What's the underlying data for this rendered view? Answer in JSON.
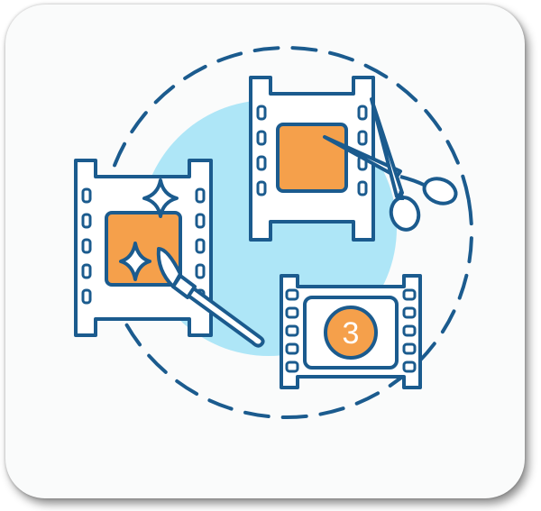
{
  "illustration": {
    "countdown_number": "3",
    "icons": [
      "film-edit-sparkle-icon",
      "film-cut-scissors-icon",
      "film-countdown-icon",
      "paintbrush-icon",
      "scissors-icon",
      "sparkle-icon"
    ],
    "colors": {
      "outline": "#1b5b8e",
      "film_fill": "#ffffff",
      "frame_fill": "#f5a04b",
      "background_circle": "#aee6f7",
      "card": "#fafbfb"
    }
  }
}
